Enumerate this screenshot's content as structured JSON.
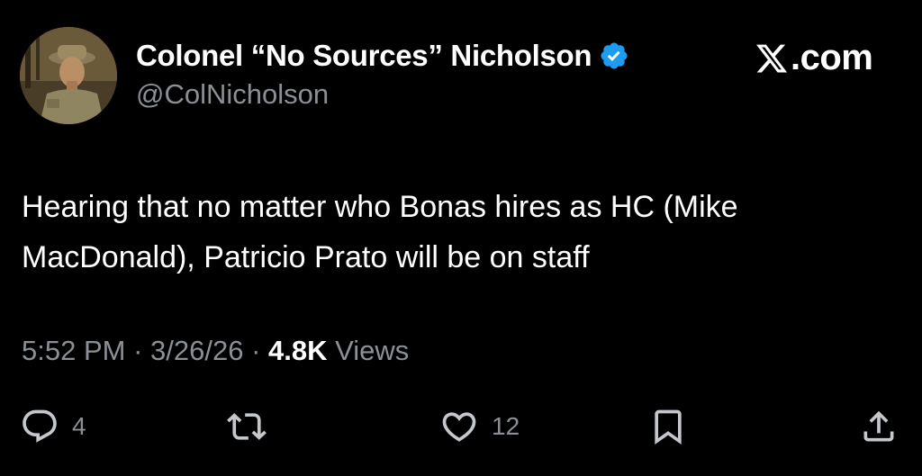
{
  "author": {
    "display_name": "Colonel “No Sources” Nicholson",
    "handle": "@ColNicholson",
    "verified": true
  },
  "brand": {
    "domain_text": ".com",
    "logo_icon": "x-logo-icon"
  },
  "tweet": {
    "text": "Hearing that no matter who Bonas hires as HC (Mike MacDonald), Patricio Prato will be on staff",
    "time": "5:52 PM",
    "sep1": " · ",
    "date": "3/26/26",
    "sep2": " · ",
    "views_count": "4.8K",
    "views_label": " Views"
  },
  "actions": {
    "reply_count": "4",
    "retweet_count": "",
    "like_count": "12"
  },
  "colors": {
    "background": "#000000",
    "text_primary": "#ffffff",
    "text_secondary": "#8b9096",
    "verified_blue": "#1d9bf0"
  }
}
